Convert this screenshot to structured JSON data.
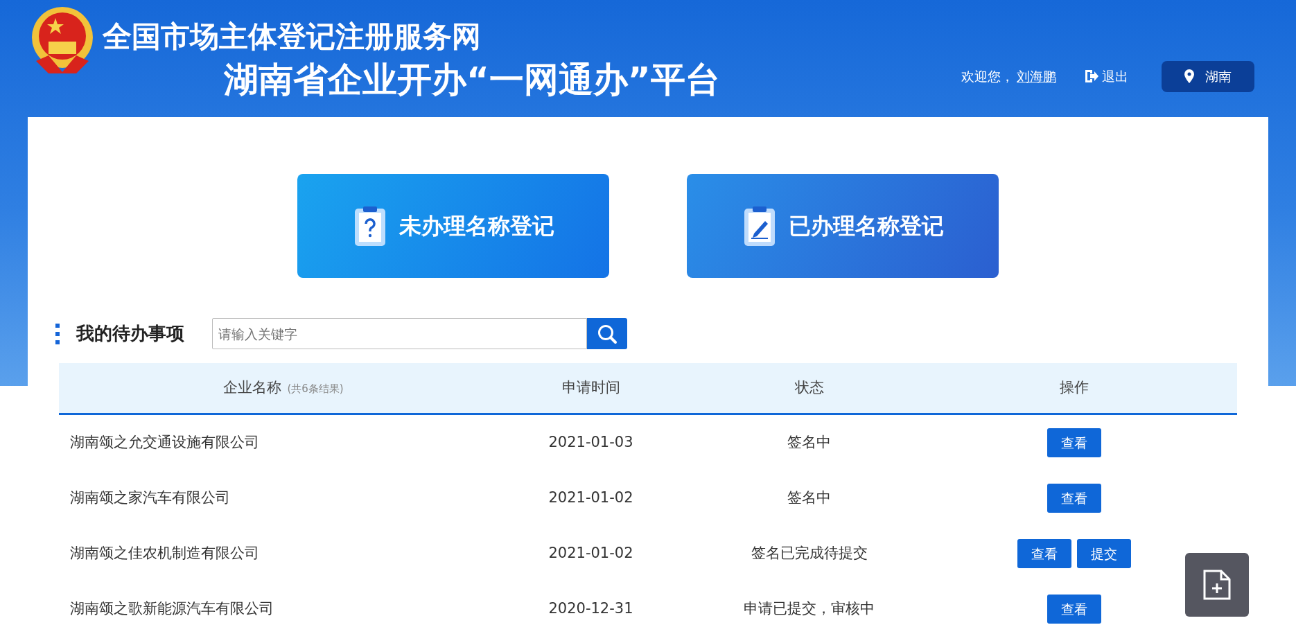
{
  "header": {
    "title": "全国市场主体登记注册服务网",
    "subtitle": "湖南省企业开办“一网通办”平台",
    "welcome": "欢迎您，",
    "user": "刘海鹏",
    "logout": "退出",
    "region": "湖南"
  },
  "entries": [
    {
      "label": "未办理名称登记",
      "kind": "pending"
    },
    {
      "label": "已办理名称登记",
      "kind": "done"
    }
  ],
  "todo": {
    "title": "我的待办事项",
    "search": {
      "placeholder": "请输入关键字"
    },
    "table": {
      "columns": [
        {
          "label": "企业名称",
          "note": "(共6条结果)"
        },
        {
          "label": "申请时间"
        },
        {
          "label": "状态"
        },
        {
          "label": "操作"
        }
      ],
      "rows": [
        {
          "name": "湖南颂之允交通设施有限公司",
          "date": "2021-01-03",
          "status": "签名中",
          "actions": [
            "查看"
          ]
        },
        {
          "name": "湖南颂之家汽车有限公司",
          "date": "2021-01-02",
          "status": "签名中",
          "actions": [
            "查看"
          ]
        },
        {
          "name": "湖南颂之佳农机制造有限公司",
          "date": "2021-01-02",
          "status": "签名已完成待提交",
          "actions": [
            "查看",
            "提交"
          ]
        },
        {
          "name": "湖南颂之歌新能源汽车有限公司",
          "date": "2020-12-31",
          "status": "申请已提交，审核中",
          "actions": [
            "查看"
          ]
        }
      ]
    }
  }
}
